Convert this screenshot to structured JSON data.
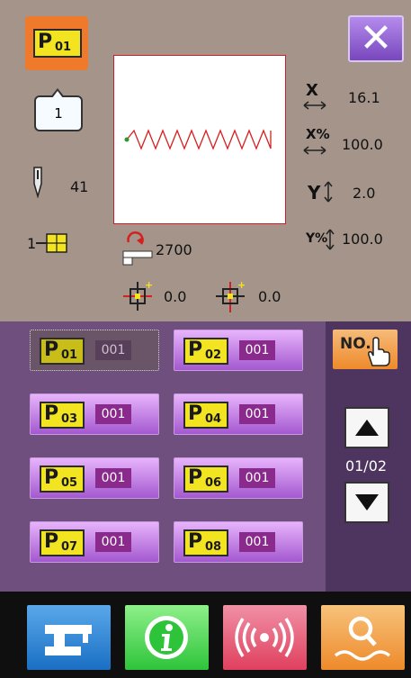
{
  "current_pattern": {
    "prefix": "P",
    "number": "01"
  },
  "bubble_value": "1",
  "needle_value": "41",
  "block_prefix": "1",
  "x_scale": {
    "symbol": "X",
    "value": "16.1"
  },
  "x_percent": {
    "symbol": "X%",
    "value": "100.0"
  },
  "y_scale": {
    "symbol": "Y",
    "value": "2.0"
  },
  "y_percent": {
    "symbol": "Y%",
    "value": "100.0"
  },
  "stitch_count": "2700",
  "origin_x": "0.0",
  "origin_y": "0.0",
  "patterns": [
    {
      "prefix": "P",
      "number": "01",
      "count": "001",
      "selected": true
    },
    {
      "prefix": "P",
      "number": "02",
      "count": "001",
      "selected": false
    },
    {
      "prefix": "P",
      "number": "03",
      "count": "001",
      "selected": false
    },
    {
      "prefix": "P",
      "number": "04",
      "count": "001",
      "selected": false
    },
    {
      "prefix": "P",
      "number": "05",
      "count": "001",
      "selected": false
    },
    {
      "prefix": "P",
      "number": "06",
      "count": "001",
      "selected": false
    },
    {
      "prefix": "P",
      "number": "07",
      "count": "001",
      "selected": false
    },
    {
      "prefix": "P",
      "number": "08",
      "count": "001",
      "selected": false
    }
  ],
  "no_button_label": "NO.",
  "page_indicator": "01/02",
  "bottom_icons": [
    "sewing-machine-icon",
    "info-icon",
    "signal-icon",
    "search-icon"
  ],
  "colors": {
    "top_bg": "#a4948a",
    "mid_bg": "#6e4f7e",
    "accent_orange": "#f07a2c",
    "stitch": "#d42020"
  }
}
